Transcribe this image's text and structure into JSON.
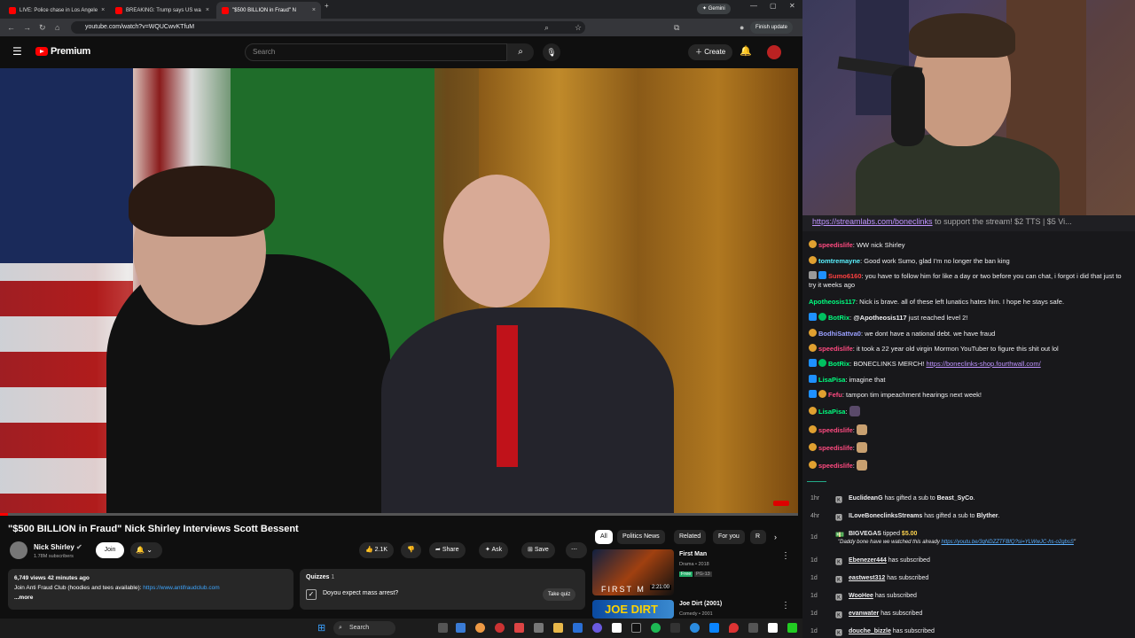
{
  "browser": {
    "tabs": [
      {
        "title": "LIVE: Police chase in Los Angele"
      },
      {
        "title": "BREAKING: Trump says US wa"
      },
      {
        "title": "\"$500 BILLION in Fraud\" N"
      }
    ],
    "url": "youtube.com/watch?v=WQUCwvKTfuM",
    "gemini_label": "Gemini",
    "finish_update_label": "Finish update"
  },
  "youtube": {
    "logo_text": "Premium",
    "search_placeholder": "Search",
    "create_label": "Create",
    "video": {
      "title": "\"$500 BILLION in Fraud\" Nick Shirley Interviews Scott Bessent",
      "progress": 0.01
    },
    "channel": {
      "name": "Nick Shirley",
      "subscribers": "1.78M subscribers",
      "join_label": "Join"
    },
    "actions": {
      "likes": "2.1K",
      "share": "Share",
      "ask": "Ask",
      "save": "Save"
    },
    "description": {
      "stats": "6,749 views  42 minutes ago",
      "text": "Join Anti Fraud Club (hoodies and tees available): ",
      "link": "https://www.antifraudclub.com",
      "more": "...more"
    },
    "quiz": {
      "header": "Quizzes",
      "count": "1",
      "question": "Doyou expect mass arrest?",
      "button": "Take quiz"
    },
    "chips": [
      "All",
      "Politics News",
      "Related",
      "For you",
      "R"
    ],
    "recommendations": [
      {
        "title": "First Man",
        "meta1": "Drama • 2018",
        "badge1": "Free",
        "badge2": "PG-13",
        "duration": "2:21:00",
        "thumb_text": "FIRST M"
      },
      {
        "title": "Joe Dirt (2001)",
        "meta1": "Comedy • 2001",
        "thumb_text": "JOE DIRT"
      }
    ]
  },
  "chat": {
    "banner_link": "https://streamlabs.com/boneclinks",
    "banner_text": " to support the stream! $2 TTS | $5 Vi...",
    "messages": [
      {
        "user": "speedislife",
        "color": "#ff4a80",
        "text": "WW nick Shirley"
      },
      {
        "user": "tomtremayne",
        "color": "#5af2ff",
        "text": "Good work Sumo, glad I'm no longer the ban king"
      },
      {
        "user": "Sumo6160",
        "color": "#ff4040",
        "text": "you have to follow him for like a day or two before you can chat, i forgot i did that just to try it weeks ago"
      },
      {
        "user": "Apotheosis117",
        "color": "#00ff7f",
        "text": "Nick is brave. all of these left lunatics hates him. I hope he stays safe."
      },
      {
        "user": "BotRix",
        "color": "#00ff7f",
        "mention": "@Apotheosis117",
        "text": " just reached level 2!"
      },
      {
        "user": "BodhiSattva0",
        "color": "#9aa0ff",
        "text": "we dont have a national debt. we have fraud"
      },
      {
        "user": "speedislife",
        "color": "#ff4a80",
        "text": "it took a 22 year old virgin Mormon YouTuber to figure this shit out lol"
      },
      {
        "user": "BotRix",
        "color": "#00ff7f",
        "text": "BONECLINKS MERCH! ",
        "link": "https://boneclinks-shop.fourthwall.com/"
      },
      {
        "user": "LisaPisa",
        "color": "#00ff7f",
        "text": "imagine that"
      },
      {
        "user": "Fefu",
        "color": "#ff4a80",
        "text": "tampon tim impeachment hearings next week!"
      },
      {
        "user": "LisaPisa",
        "color": "#00ff7f",
        "text": ""
      },
      {
        "user": "speedislife",
        "color": "#ff4a80",
        "text": ""
      },
      {
        "user": "speedislife",
        "color": "#ff4a80",
        "text": ""
      },
      {
        "user": "speedislife",
        "color": "#ff4a80",
        "text": ""
      }
    ]
  },
  "events": [
    {
      "time": "1hr",
      "user": "EuclideanG",
      "text": " has gifted a sub to ",
      "target": "Beast_SyCo",
      "suffix": "."
    },
    {
      "time": "4hr",
      "user": "ILoveBoneclinksStreams",
      "text": " has gifted a sub to ",
      "target": "Blyther",
      "suffix": "."
    },
    {
      "time": "1d",
      "user": "BIGVEGAS",
      "text": " tipped ",
      "amount": "$5.00",
      "sub": "\"Daddy bone have we watched this already ",
      "sublink": "https://youtu.be/3qNDZZTFBfQ?si=YLWwJC-hs-o2gbsS",
      "subend": "\""
    },
    {
      "time": "1d",
      "user": "Ebenezer444",
      "text": " has subscribed"
    },
    {
      "time": "1d",
      "user": "eastwest312",
      "text": " has subscribed"
    },
    {
      "time": "1d",
      "user": "WooHee",
      "text": " has subscribed"
    },
    {
      "time": "1d",
      "user": "evanwater",
      "text": " has subscribed"
    },
    {
      "time": "1d",
      "user": "douche_bizzle",
      "text": " has subscribed"
    }
  ],
  "taskbar": {
    "search_label": "Search"
  }
}
